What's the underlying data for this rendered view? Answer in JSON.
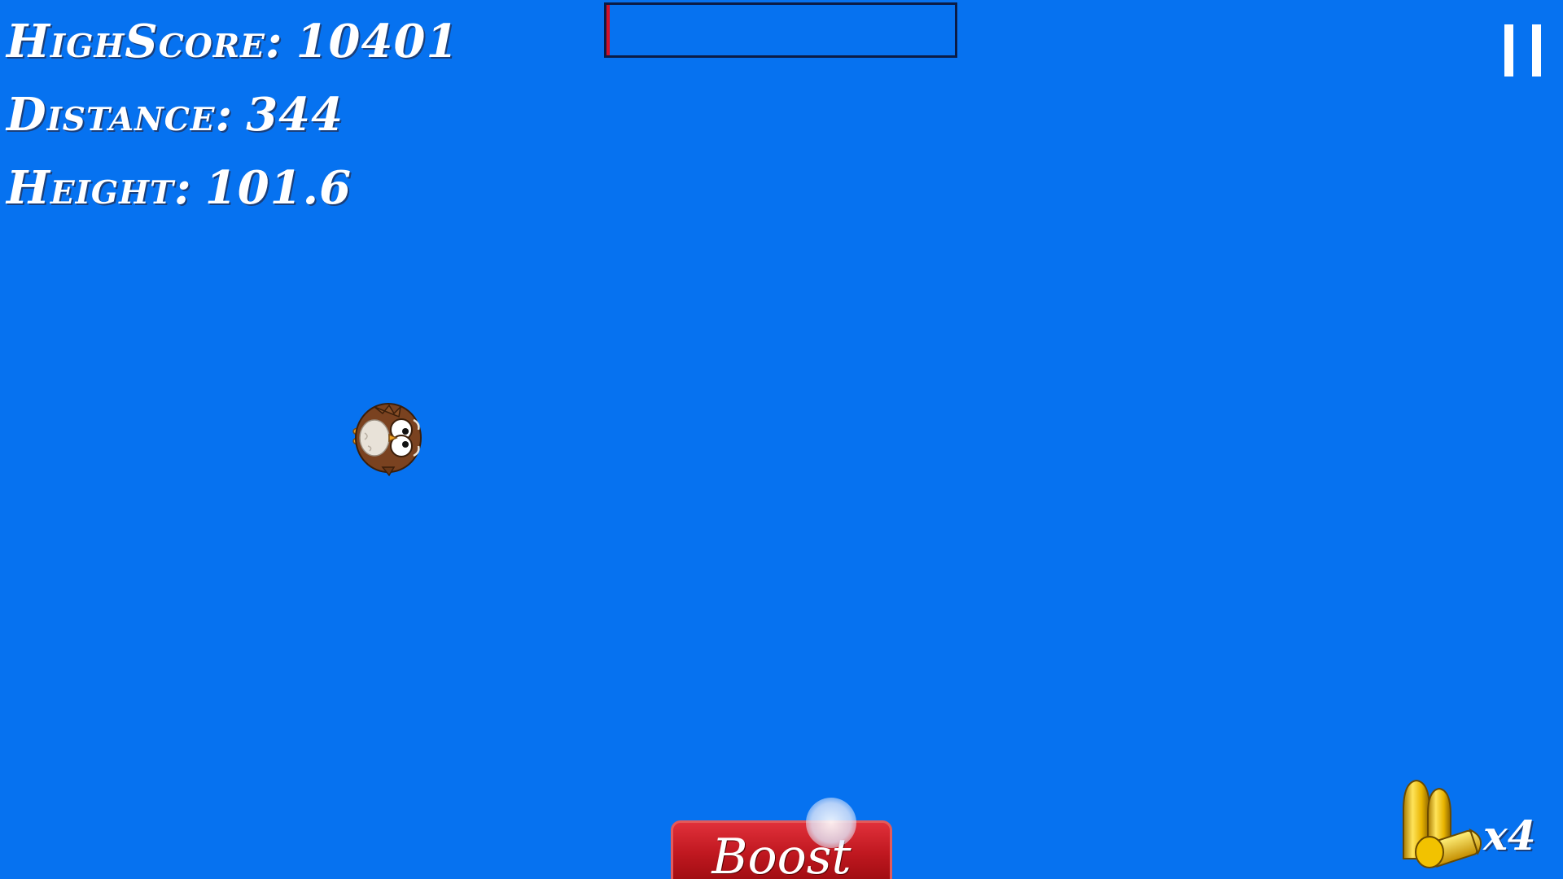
{
  "hud": {
    "highscore_label": "HighScore:",
    "highscore_value": "10401",
    "distance_label": "Distance:",
    "distance_value": "344",
    "height_label": "Height:",
    "height_value": "101.6"
  },
  "progress": {
    "fill_fraction": 0.01,
    "fill_color": "#d3102a",
    "frame_color": "#0b1c46"
  },
  "controls": {
    "pause_icon": "pause-icon",
    "boost_label": "Boost"
  },
  "player": {
    "icon": "owl-icon"
  },
  "ammo": {
    "icon": "bullets-icon",
    "count": "x4"
  },
  "colors": {
    "sky": "#0672f0",
    "boost": "#c01820",
    "text": "#ffffff"
  }
}
